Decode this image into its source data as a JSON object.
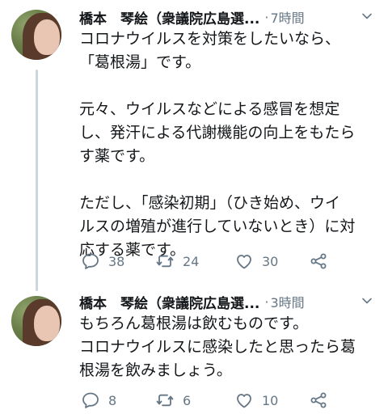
{
  "tweets": [
    {
      "author_name": "橋本　琴絵（衆議院広島選...",
      "time": "7時間",
      "paragraphs": [
        "コロナウイルスを対策をしたいなら、\n「葛根湯」です。",
        "元々、ウイルスなどによる感冒を想定\nし、発汗による代謝機能の向上をもたら\nす薬です。",
        "ただし、「感染初期」（ひき始め、ウイ\nルスの増殖が進行していないとき）に対\n応する薬です。"
      ],
      "replies": "38",
      "retweets": "24",
      "likes": "30"
    },
    {
      "author_name": "橋本　琴絵（衆議院広島選...",
      "time": "3時間",
      "paragraphs": [
        "もちろん葛根湯は飲むものです。\nコロナウイルスに感染したと思ったら葛\n根湯を飲みましょう。"
      ],
      "replies": "8",
      "retweets": "6",
      "likes": "10"
    }
  ],
  "separator": "·",
  "icons": {
    "reply": "reply-icon",
    "retweet": "retweet-icon",
    "like": "heart-icon",
    "share": "share-icon",
    "more": "chevron-down-icon"
  },
  "colors": {
    "text": "#14171a",
    "secondary": "#657786",
    "thread_line": "#ccd6dd"
  }
}
